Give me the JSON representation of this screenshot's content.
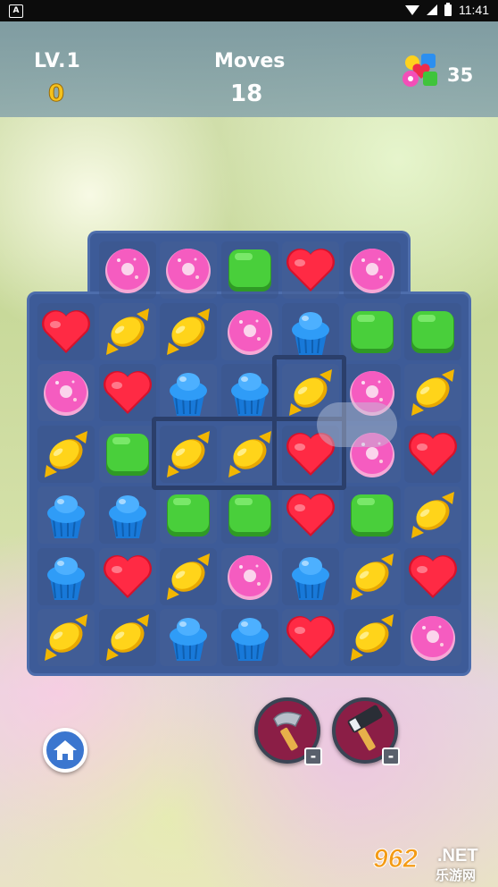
{
  "status_bar": {
    "time": "11:41",
    "notification_icon": "A"
  },
  "hud": {
    "level_label": "LV.1",
    "score": "0",
    "moves_label": "Moves",
    "moves_value": "18",
    "target_count": "35"
  },
  "board": {
    "rows": [
      [
        null,
        "donut",
        "donut",
        "jelly",
        "heart",
        "donut",
        null
      ],
      [
        "heart",
        "candy",
        "candy",
        "donut",
        "cupcake",
        "jelly",
        "jelly"
      ],
      [
        "donut",
        "heart",
        "cupcake",
        "cupcake",
        "candy",
        "donut",
        "candy"
      ],
      [
        "candy",
        "jelly",
        "candy",
        "candy",
        "heart",
        "donut",
        "heart"
      ],
      [
        "cupcake",
        "cupcake",
        "jelly",
        "jelly",
        "heart",
        "jelly",
        "candy"
      ],
      [
        "cupcake",
        "heart",
        "candy",
        "donut",
        "cupcake",
        "candy",
        "heart"
      ],
      [
        "candy",
        "candy",
        "cupcake",
        "cupcake",
        "heart",
        "candy",
        "donut"
      ]
    ],
    "highlight": "hint-match"
  },
  "tools": {
    "home_icon": "home-icon",
    "hammer_badge": "-",
    "mallet_badge": "-"
  },
  "watermark": {
    "number": "962",
    "suffix": ".NET",
    "chinese": "乐游网"
  },
  "colors": {
    "board": "#3d5b98",
    "score": "#f6c21b",
    "tool_bg": "#8b1e46",
    "home_bg": "#3b76cf"
  }
}
